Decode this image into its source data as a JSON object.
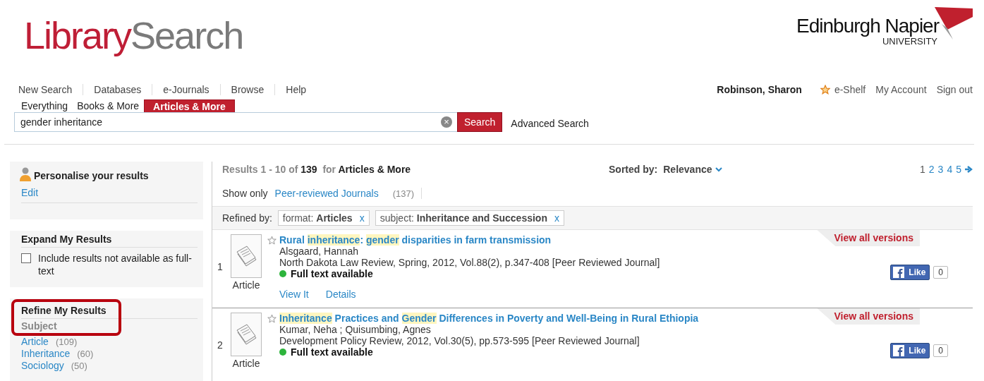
{
  "header": {
    "logo_first": "Library",
    "logo_second": "Search",
    "university": "Edinburgh Napier",
    "university_sub": "UNIVERSITY"
  },
  "nav": [
    "New Search",
    "Databases",
    "e-Journals",
    "Browse",
    "Help"
  ],
  "user": {
    "name": "Robinson, Sharon",
    "eshelf": "e-Shelf",
    "account": "My Account",
    "signout": "Sign out"
  },
  "scopes": [
    {
      "label": "Everything",
      "selected": false
    },
    {
      "label": "Books & More",
      "selected": false
    },
    {
      "label": "Articles & More",
      "selected": true
    }
  ],
  "search": {
    "value": "gender inheritance",
    "clear": "×",
    "button": "Search",
    "advanced": "Advanced Search"
  },
  "sidebar": {
    "personalise": {
      "title": "Personalise your results",
      "link": "Edit"
    },
    "expand": {
      "title": "Expand My Results",
      "option": "Include results not available as full-text",
      "checked": false
    },
    "refine": {
      "title": "Refine My Results",
      "group": "Subject",
      "facets": [
        {
          "label": "Article",
          "count": "(109)"
        },
        {
          "label": "Inheritance",
          "count": "(60)"
        },
        {
          "label": "Sociology",
          "count": "(50)"
        }
      ]
    }
  },
  "results": {
    "summary_range": "Results 1 - 10 of",
    "total": "139",
    "for": "for",
    "scope": "Articles & More",
    "sort_label": "Sorted by:",
    "sort_value": "Relevance",
    "pages": [
      {
        "label": "1",
        "selected": true
      },
      {
        "label": "2",
        "selected": false
      },
      {
        "label": "3",
        "selected": false
      },
      {
        "label": "4",
        "selected": false
      },
      {
        "label": "5",
        "selected": false
      }
    ],
    "show_only": "Show only",
    "filter_link": "Peer-reviewed Journals",
    "filter_count": "(137)",
    "refined_label": "Refined by:",
    "refinements": [
      {
        "field": "format:",
        "value": "Articles",
        "remove": "x"
      },
      {
        "field": "subject:",
        "value": "Inheritance and Succession",
        "remove": "x"
      }
    ],
    "items": [
      {
        "number": "1",
        "type": "Article",
        "title": [
          {
            "text": "Rural ",
            "highlight": false
          },
          {
            "text": "inheritance",
            "highlight": true
          },
          {
            "text": ": ",
            "highlight": false
          },
          {
            "text": "gender",
            "highlight": true
          },
          {
            "text": " disparities in farm transmission",
            "highlight": false
          }
        ],
        "author": "Alsgaard, Hannah",
        "source": "North Dakota Law Review, Spring, 2012, Vol.88(2), p.347-408 [Peer Reviewed Journal]",
        "availability": "Full text available",
        "available": true,
        "links": [
          "View It",
          "Details"
        ],
        "versions": "View all versions",
        "like": "Like",
        "like_count": "0"
      },
      {
        "number": "2",
        "type": "Article",
        "title": [
          {
            "text": "Inheritance",
            "highlight": true
          },
          {
            "text": " Practices and ",
            "highlight": false
          },
          {
            "text": "Gender",
            "highlight": true
          },
          {
            "text": " Differences in Poverty and Well-Being in Rural Ethiopia",
            "highlight": false
          }
        ],
        "author": "Kumar, Neha ; Quisumbing, Agnes",
        "source": "Development Policy Review, 2012, Vol.30(5), pp.573-595 [Peer Reviewed Journal]",
        "availability": "Full text available",
        "available": true,
        "versions": "View all versions",
        "like": "Like",
        "like_count": "0"
      }
    ]
  }
}
